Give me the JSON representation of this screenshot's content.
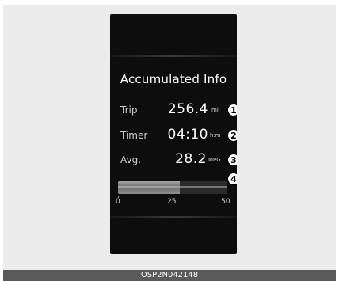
{
  "screen": {
    "title": "Accumulated Info",
    "rows": [
      {
        "label": "Trip",
        "value": "256.4",
        "unit": "mi",
        "callout": "1"
      },
      {
        "label": "Timer",
        "value": "04:10",
        "unit": "h:m",
        "callout": "2"
      },
      {
        "label": "Avg.",
        "value": "28.2",
        "unit": "MPG",
        "callout": "3"
      }
    ],
    "gauge": {
      "callout": "4",
      "min": 0,
      "max": 50,
      "value": 28.2,
      "ticks": [
        "0",
        "25",
        "50"
      ]
    }
  },
  "caption": "OSP2N042148",
  "colors": {
    "display_bg": "#0d0d0d",
    "text": "#ffffff",
    "label_text": "#cfcfcf",
    "caption_bg": "#5a5a5a"
  }
}
